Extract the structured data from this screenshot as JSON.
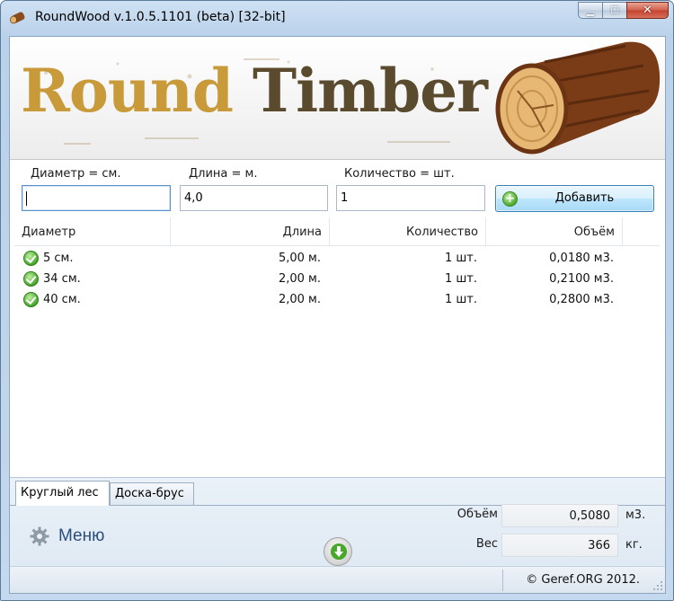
{
  "window": {
    "title": "RoundWood v.1.0.5.1101 (beta) [32-bit]",
    "buttons": {
      "minimize": "▁",
      "maximize": "☐",
      "close": "✕"
    }
  },
  "banner": {
    "word1": "Round",
    "word2": "Timber"
  },
  "form": {
    "diameter_label": "Диаметр = см.",
    "diameter_value": "",
    "length_label": "Длина = м.",
    "length_value": "4,0",
    "quantity_label": "Количество = шт.",
    "quantity_value": "1",
    "add_button": "Добавить"
  },
  "table": {
    "columns": [
      "Диаметр",
      "Длина",
      "Количество",
      "Объём"
    ],
    "rows": [
      {
        "diameter": "5 см.",
        "length": "5,00 м.",
        "quantity": "1 шт.",
        "volume": "0,0180 м3."
      },
      {
        "diameter": "34 см.",
        "length": "2,00 м.",
        "quantity": "1 шт.",
        "volume": "0,2100 м3."
      },
      {
        "diameter": "40 см.",
        "length": "2,00 м.",
        "quantity": "1 шт.",
        "volume": "0,2800 м3."
      }
    ]
  },
  "tabs": [
    {
      "label": "Круглый лес",
      "active": true
    },
    {
      "label": "Доска-брус",
      "active": false
    }
  ],
  "menu": {
    "label": "Меню"
  },
  "summary": {
    "volume_label": "Объём",
    "volume_value": "0,5080",
    "volume_unit": "м3.",
    "weight_label": "Вес",
    "weight_value": "366",
    "weight_unit": "кг."
  },
  "status": {
    "copyright": "© Geref.ORG 2012."
  },
  "colors": {
    "banner_gold": "#c89a3a",
    "banner_brown": "#5a4a2e",
    "menu_blue": "#2b4f7a",
    "ok_green": "#3fa125"
  }
}
